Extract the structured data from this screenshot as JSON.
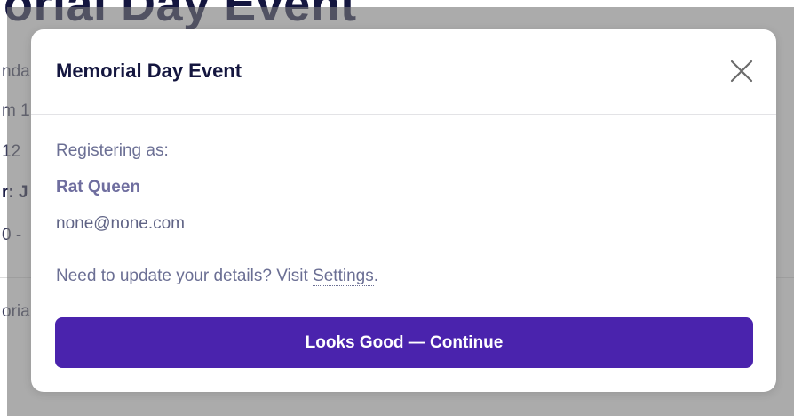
{
  "background": {
    "title": "orial Day Event",
    "lines": [
      "nda",
      "m 1",
      "12",
      "r: J",
      "0 -",
      "oria"
    ]
  },
  "modal": {
    "title": "Memorial Day Event",
    "close_icon": "close-icon",
    "registering_label": "Registering as:",
    "user_name": "Rat Queen",
    "user_email": "none@none.com",
    "update_prefix": "Need to update your details? Visit ",
    "settings_link": "Settings",
    "update_suffix": ".",
    "continue_label": "Looks Good — Continue"
  },
  "colors": {
    "accent": "#4a23ad",
    "title_text": "#14163f",
    "muted_text": "#6b6f94"
  }
}
